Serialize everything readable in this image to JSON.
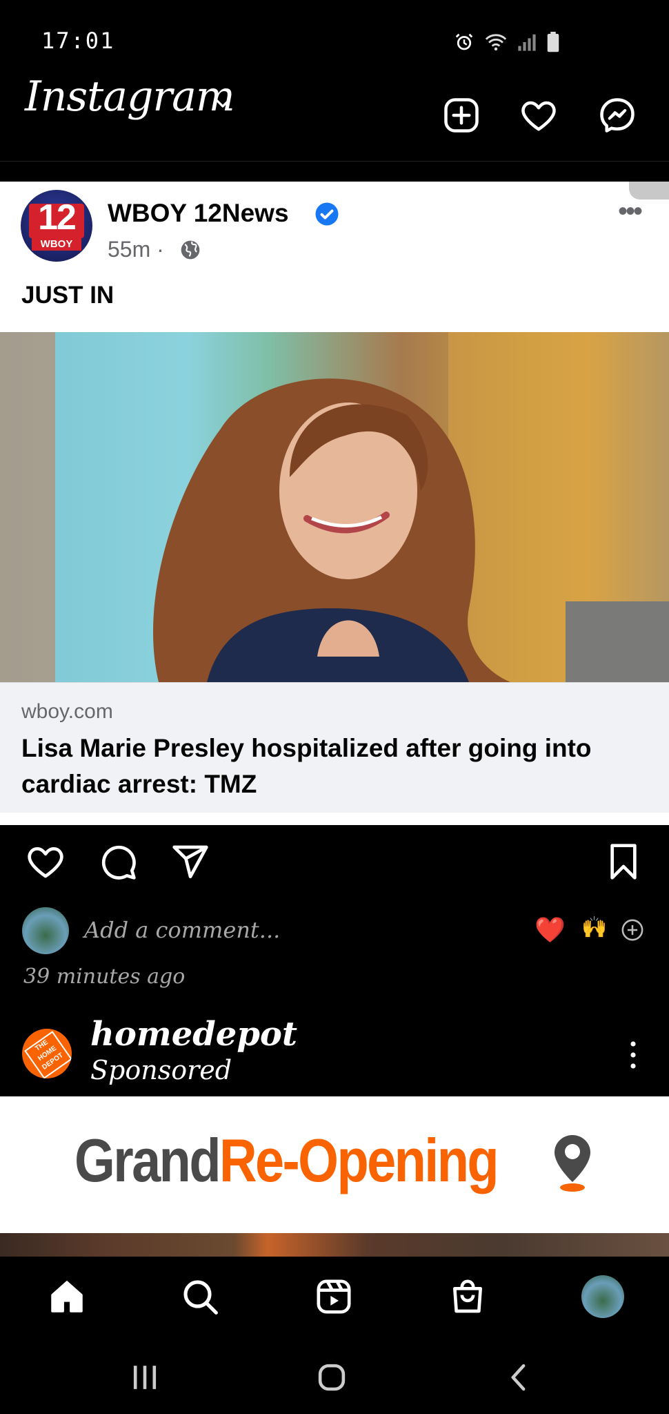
{
  "status_bar": {
    "time": "17:01"
  },
  "app": {
    "title": "Instagram"
  },
  "header_icons": [
    "plus-square-icon",
    "heart-icon",
    "messenger-icon"
  ],
  "post": {
    "page_name": "WBOY 12News",
    "avatar_number": "12",
    "avatar_call_sign": "WBOY",
    "time": "55m ·",
    "text": "JUST IN",
    "link_domain": "wboy.com",
    "link_title": "Lisa Marie Presley hospitalized after going into cardiac arrest: TMZ",
    "comment_placeholder": "Add a comment...",
    "quick_reactions": [
      "❤️",
      "🙌"
    ],
    "age": "39 minutes ago"
  },
  "sponsored": {
    "name": "homedepot",
    "label": "Sponsored",
    "avatar_text": "THE HOME DEPOT",
    "ad_text_part1": "Grand",
    "ad_text_part2": "Re-Opening"
  },
  "colors": {
    "background": "#000000",
    "brand_orange": "#f96302",
    "verified_blue": "#1877f2",
    "reaction_red": "#e0245e"
  },
  "bottom_nav": [
    "home-icon",
    "search-icon",
    "reels-icon",
    "shop-icon",
    "profile-avatar"
  ],
  "system_nav": [
    "recent-apps-button",
    "home-button",
    "back-button"
  ]
}
